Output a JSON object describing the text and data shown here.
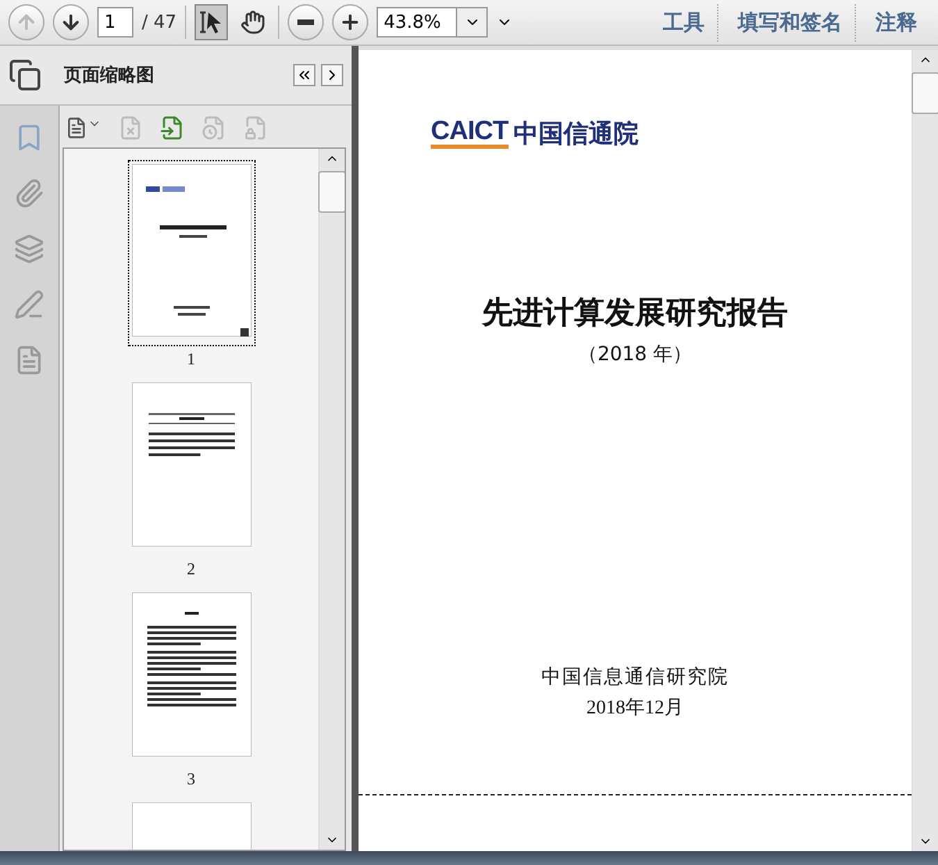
{
  "toolbar": {
    "page_field": {
      "value": "1"
    },
    "page_total": "/ 47",
    "tools": [
      {
        "kind": "select",
        "selected": true
      },
      {
        "kind": "hand",
        "selected": false
      }
    ],
    "zoom_field": {
      "value": "43.8%"
    },
    "menus": [
      "工具",
      "填写和签名",
      "注释"
    ]
  },
  "sidebar": {
    "panel_title": "页面缩略图",
    "thumbnails": [
      {
        "kind": "cover",
        "label": "1",
        "selected": true
      },
      {
        "kind": "text",
        "label": "2",
        "selected": false
      },
      {
        "kind": "preface",
        "label": "3",
        "selected": false
      },
      {
        "kind": "blank",
        "selected": false
      }
    ]
  },
  "document": {
    "logo_mark": "CAICT",
    "logo_name": "中国信通院",
    "title": "先进计算发展研究报告",
    "subtitle": "（2018 年）",
    "organization": "中国信息通信研究院",
    "date": "2018年12月"
  }
}
